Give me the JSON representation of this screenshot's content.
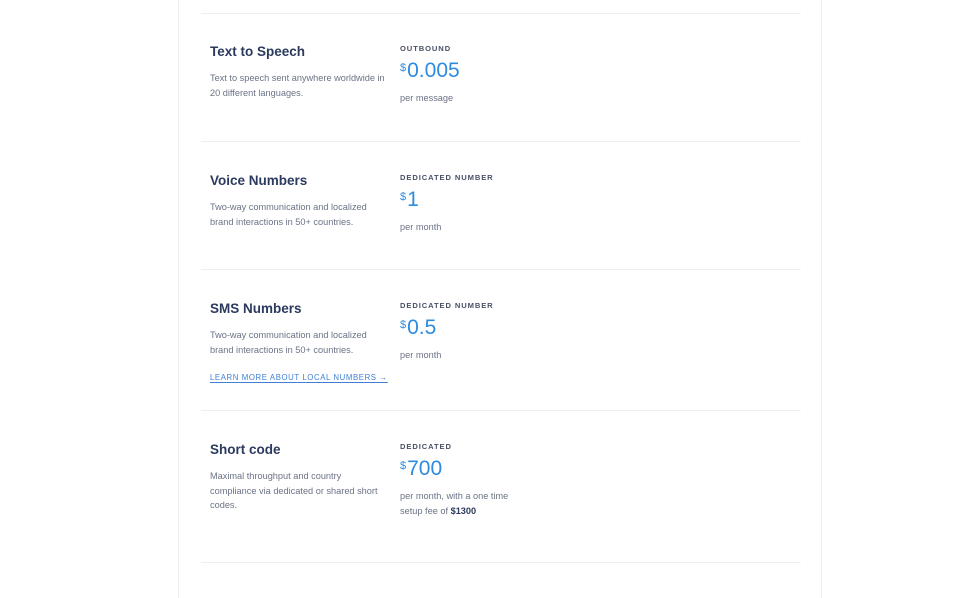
{
  "products": [
    {
      "name": "Text to Speech",
      "description": "Text to speech sent anywhere worldwide in 20 different languages.",
      "price_label": "OUTBOUND",
      "currency": "$",
      "amount": "0.005",
      "unit": "per message"
    },
    {
      "name": "Voice Numbers",
      "description": "Two-way communication and localized brand interactions in 50+ countries.",
      "price_label": "DEDICATED NUMBER",
      "currency": "$",
      "amount": "1",
      "unit": "per month"
    },
    {
      "name": "SMS Numbers",
      "description": "Two-way communication and localized brand interactions in 50+ countries.",
      "link": "LEARN MORE ABOUT LOCAL NUMBERS →",
      "price_label": "DEDICATED NUMBER",
      "currency": "$",
      "amount": "0.5",
      "unit": "per month"
    },
    {
      "name": "Short code",
      "description": "Maximal throughput and country compliance via dedicated or shared short codes.",
      "price_label": "DEDICATED",
      "currency": "$",
      "amount": "700",
      "unit": "per month, with a one time setup fee of",
      "setup_fee": "$1300"
    }
  ]
}
